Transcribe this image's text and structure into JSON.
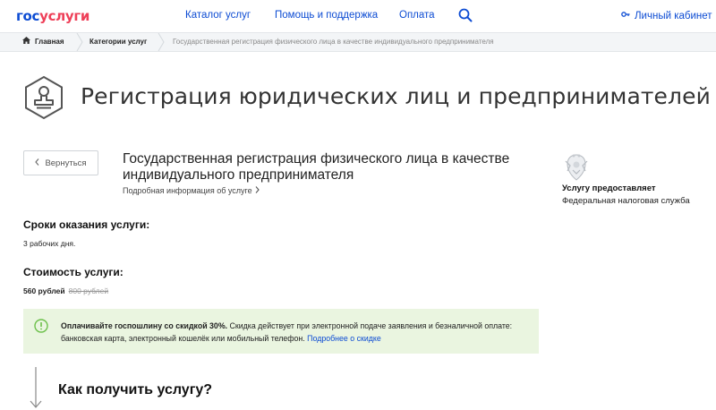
{
  "header": {
    "logo_part1": "гос",
    "logo_part2": "услуги",
    "nav": [
      "Каталог услуг",
      "Помощь и поддержка",
      "Оплата"
    ],
    "cabinet": "Личный кабинет",
    "icons": [
      "search-icon",
      "key-icon"
    ]
  },
  "breadcrumb": {
    "home": "Главная",
    "category": "Категории услуг",
    "current": "Государственная регистрация физического лица в качестве индивидуального предпринимателя"
  },
  "page": {
    "title": "Регистрация юридических лиц и предпринимателей",
    "back_label": "Вернуться",
    "service_title": "Государственная регистрация физического лица в качестве индивидуального предпринимателя",
    "service_more": "Подробная информация об услуге"
  },
  "provider": {
    "heading": "Услугу предоставляет",
    "name": "Федеральная налоговая служба"
  },
  "terms": {
    "heading": "Сроки оказания услуги:",
    "value": "3 рабочих дня."
  },
  "cost": {
    "heading": "Стоимость услуги:",
    "new_price": "560 рублей",
    "old_price": "800 рублей"
  },
  "notice": {
    "bold": "Оплачивайте госпошлину со скидкой 30%.",
    "text": " Скидка действует при электронной подаче заявления и безналичной оплате: банковская карта, электронный кошелёк или мобильный телефон. ",
    "link": "Подробнее о скидке"
  },
  "how": {
    "title": "Как получить услугу?"
  },
  "colors": {
    "brand_blue": "#0d4cd3",
    "brand_red": "#ee3f58",
    "notice_bg": "#eaf5e0",
    "notice_icon": "#6cc04a"
  }
}
